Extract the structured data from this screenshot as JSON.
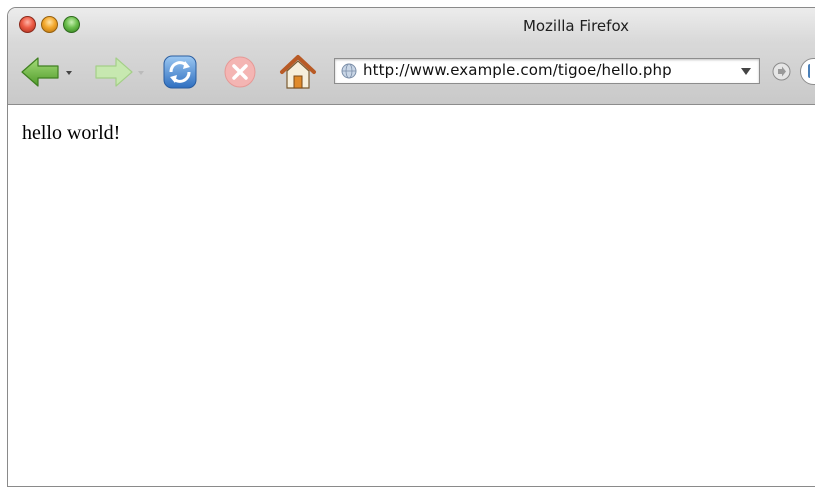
{
  "window": {
    "title": "Mozilla Firefox"
  },
  "toolbar": {
    "back_icon": "back-arrow-icon",
    "forward_icon": "forward-arrow-icon",
    "reload_icon": "reload-icon",
    "stop_icon": "stop-icon",
    "home_icon": "home-icon",
    "url": "http://www.example.com/tigoe/hello.php",
    "go_icon": "go-icon"
  },
  "page": {
    "body_text": "hello world!"
  },
  "colors": {
    "back_arrow": "#6fb443",
    "forward_arrow_disabled": "#b8df9e",
    "reload": "#3f7fd0",
    "stop_disabled": "#f2aaa8",
    "home_roof": "#c0632a"
  }
}
